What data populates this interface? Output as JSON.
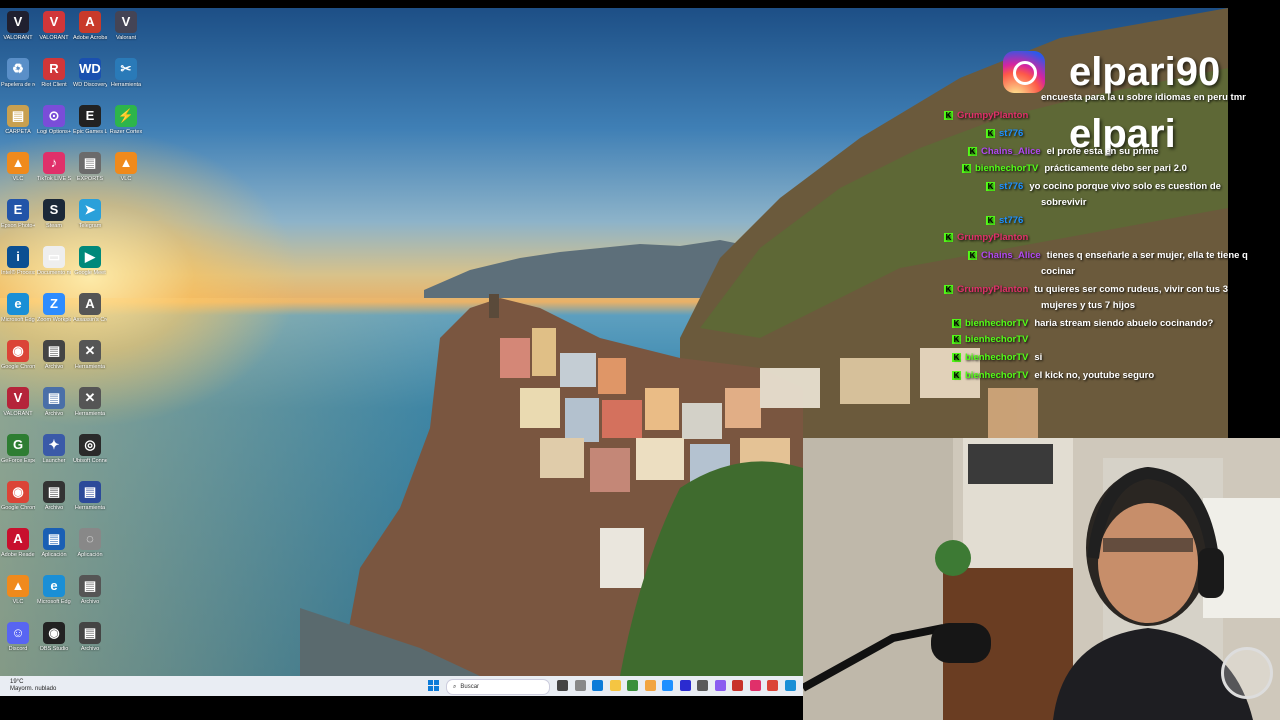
{
  "desktop_icons": [
    {
      "label": "VALORANT",
      "color": "#202030",
      "glyph": "V",
      "col": 0,
      "row": 0
    },
    {
      "label": "VALORANT",
      "color": "#d13639",
      "glyph": "V",
      "col": 1,
      "row": 0
    },
    {
      "label": "Adobe Acrobat Rea...",
      "color": "#c83a2a",
      "glyph": "A",
      "col": 2,
      "row": 0
    },
    {
      "label": "Valorant",
      "color": "#445",
      "glyph": "V",
      "col": 3,
      "row": 0
    },
    {
      "label": "Papelera de reciclaje",
      "color": "#5a8fc8",
      "glyph": "♻",
      "col": 0,
      "row": 1
    },
    {
      "label": "Riot Client",
      "color": "#d13639",
      "glyph": "R",
      "col": 1,
      "row": 1
    },
    {
      "label": "WD Discovery",
      "color": "#1a50b0",
      "glyph": "WD",
      "col": 2,
      "row": 1
    },
    {
      "label": "Herramienta",
      "color": "#2a7ab8",
      "glyph": "✂",
      "col": 3,
      "row": 1
    },
    {
      "label": "CARPETA",
      "color": "#c8a050",
      "glyph": "▤",
      "col": 0,
      "row": 2
    },
    {
      "label": "Logi Options+",
      "color": "#7a4dd8",
      "glyph": "⊙",
      "col": 1,
      "row": 2
    },
    {
      "label": "Epic Games Launcher",
      "color": "#222",
      "glyph": "E",
      "col": 2,
      "row": 2
    },
    {
      "label": "Razer Cortex",
      "color": "#2db54b",
      "glyph": "⚡",
      "col": 3,
      "row": 2
    },
    {
      "label": "VLC",
      "color": "#f08a1c",
      "glyph": "▲",
      "col": 0,
      "row": 3
    },
    {
      "label": "TikTok LIVE Studio",
      "color": "#e0306a",
      "glyph": "♪",
      "col": 1,
      "row": 3
    },
    {
      "label": "EXPORTS",
      "color": "#6b6b6b",
      "glyph": "▤",
      "col": 2,
      "row": 3
    },
    {
      "label": "VLC",
      "color": "#f08a1c",
      "glyph": "▲",
      "col": 3,
      "row": 3
    },
    {
      "label": "Epson Photo+",
      "color": "#2254a8",
      "glyph": "E",
      "col": 0,
      "row": 4
    },
    {
      "label": "Steam",
      "color": "#1b2838",
      "glyph": "S",
      "col": 1,
      "row": 4
    },
    {
      "label": "Telegram",
      "color": "#2aa0da",
      "glyph": "➤",
      "col": 2,
      "row": 4
    },
    {
      "label": "Intel® Processor...",
      "color": "#0b4f92",
      "glyph": "i",
      "col": 0,
      "row": 5
    },
    {
      "label": "Documento nuevo",
      "color": "#eeeeee",
      "glyph": "▭",
      "col": 1,
      "row": 5
    },
    {
      "label": "Google Meet",
      "color": "#00897b",
      "glyph": "▶",
      "col": 2,
      "row": 5
    },
    {
      "label": "Microsoft Edge",
      "color": "#1a8fd6",
      "glyph": "e",
      "col": 0,
      "row": 6
    },
    {
      "label": "Zoom Workplace",
      "color": "#2d8cff",
      "glyph": "Z",
      "col": 1,
      "row": 6
    },
    {
      "label": "Assassin's Creed",
      "color": "#555",
      "glyph": "A",
      "col": 2,
      "row": 6
    },
    {
      "label": "Google Chrome",
      "color": "#db4437",
      "glyph": "◉",
      "col": 0,
      "row": 7
    },
    {
      "label": "Archivo",
      "color": "#444",
      "glyph": "▤",
      "col": 1,
      "row": 7
    },
    {
      "label": "Herramienta",
      "color": "#555",
      "glyph": "✕",
      "col": 2,
      "row": 7
    },
    {
      "label": "VALORANT",
      "color": "#b5243a",
      "glyph": "V",
      "col": 0,
      "row": 8
    },
    {
      "label": "Archivo",
      "color": "#4a6fa8",
      "glyph": "▤",
      "col": 1,
      "row": 8
    },
    {
      "label": "Herramienta",
      "color": "#555",
      "glyph": "✕",
      "col": 2,
      "row": 8
    },
    {
      "label": "GeForce Experience",
      "color": "#2e7d32",
      "glyph": "G",
      "col": 0,
      "row": 9
    },
    {
      "label": "Launcher",
      "color": "#3a5aa8",
      "glyph": "✦",
      "col": 1,
      "row": 9
    },
    {
      "label": "Ubisoft Connect",
      "color": "#2a2a2a",
      "glyph": "◎",
      "col": 2,
      "row": 9
    },
    {
      "label": "Google Chrome",
      "color": "#db4437",
      "glyph": "◉",
      "col": 0,
      "row": 10
    },
    {
      "label": "Archivo",
      "color": "#333",
      "glyph": "▤",
      "col": 1,
      "row": 10
    },
    {
      "label": "Herramienta",
      "color": "#2c4a9a",
      "glyph": "▤",
      "col": 2,
      "row": 10
    },
    {
      "label": "Adobe Reader",
      "color": "#c8102e",
      "glyph": "A",
      "col": 0,
      "row": 11
    },
    {
      "label": "Aplicación",
      "color": "#1a5fb4",
      "glyph": "▤",
      "col": 1,
      "row": 11
    },
    {
      "label": "Aplicación",
      "color": "#888",
      "glyph": "◌",
      "col": 2,
      "row": 11
    },
    {
      "label": "VLC",
      "color": "#f08a1c",
      "glyph": "▲",
      "col": 0,
      "row": 12
    },
    {
      "label": "Microsoft Edge",
      "color": "#1a8fd6",
      "glyph": "e",
      "col": 1,
      "row": 12
    },
    {
      "label": "Archivo",
      "color": "#555",
      "glyph": "▤",
      "col": 2,
      "row": 12
    },
    {
      "label": "Discord",
      "color": "#5865f2",
      "glyph": "☺",
      "col": 0,
      "row": 13
    },
    {
      "label": "OBS Studio",
      "color": "#222",
      "glyph": "◉",
      "col": 1,
      "row": 13
    },
    {
      "label": "Archivo",
      "color": "#444",
      "glyph": "▤",
      "col": 2,
      "row": 13
    }
  ],
  "taskbar": {
    "weather_temp": "19°C",
    "weather_desc": "Mayorm. nublado",
    "search_placeholder": "Buscar",
    "pinned_colors": [
      "#444",
      "#888",
      "#0c7bd8",
      "#f5c542",
      "#3a8f3a",
      "#f2a541",
      "#1e90ff",
      "#2b2bd0",
      "#5a5a5a",
      "#8a5cf0",
      "#c8322a",
      "#e0306a",
      "#db4437",
      "#1a8fd6"
    ]
  },
  "overlay": {
    "instagram_handle": "elpari90",
    "kick_handle": "elpari",
    "poll_text": "encuesta para la u sobre idiomas en peru tmr",
    "chat": [
      {
        "user": "GrumpyPlanton",
        "user_color": "#e0306a",
        "text": ""
      },
      {
        "user": "st776",
        "user_color": "#1e90ff",
        "text": ""
      },
      {
        "user": "Chains_Alice",
        "user_color": "#b048f0",
        "text": "el profe esta en su prime"
      },
      {
        "user": "bienhechorTV",
        "user_color": "#53fc18",
        "text": "prácticamente debo ser pari 2.0"
      },
      {
        "user": "st776",
        "user_color": "#1e90ff",
        "text": "yo cocino porque vivo solo es cuestion de"
      },
      {
        "user": "",
        "user_color": "#ffffff",
        "text": "sobrevivir"
      },
      {
        "user": "st776",
        "user_color": "#1e90ff",
        "text": ""
      },
      {
        "user": "GrumpyPlanton",
        "user_color": "#e0306a",
        "text": ""
      },
      {
        "user": "Chains_Alice",
        "user_color": "#b048f0",
        "text": "tienes q enseñarle a ser mujer, ella te tiene q"
      },
      {
        "user": "",
        "user_color": "#ffffff",
        "text": "cocinar"
      },
      {
        "user": "GrumpyPlanton",
        "user_color": "#e0306a",
        "text": "tu quieres ser como rudeus, vivir con tus 3"
      },
      {
        "user": "",
        "user_color": "#ffffff",
        "text": "mujeres y tus 7 hijos"
      },
      {
        "user": "bienhechorTV",
        "user_color": "#53fc18",
        "text": "haria stream siendo abuelo cocinando?"
      },
      {
        "user": "bienhechorTV",
        "user_color": "#53fc18",
        "text": ""
      },
      {
        "user": "bienhechorTV",
        "user_color": "#53fc18",
        "text": "si"
      },
      {
        "user": "bienhechorTV",
        "user_color": "#53fc18",
        "text": "el kick no, youtube seguro"
      }
    ]
  }
}
